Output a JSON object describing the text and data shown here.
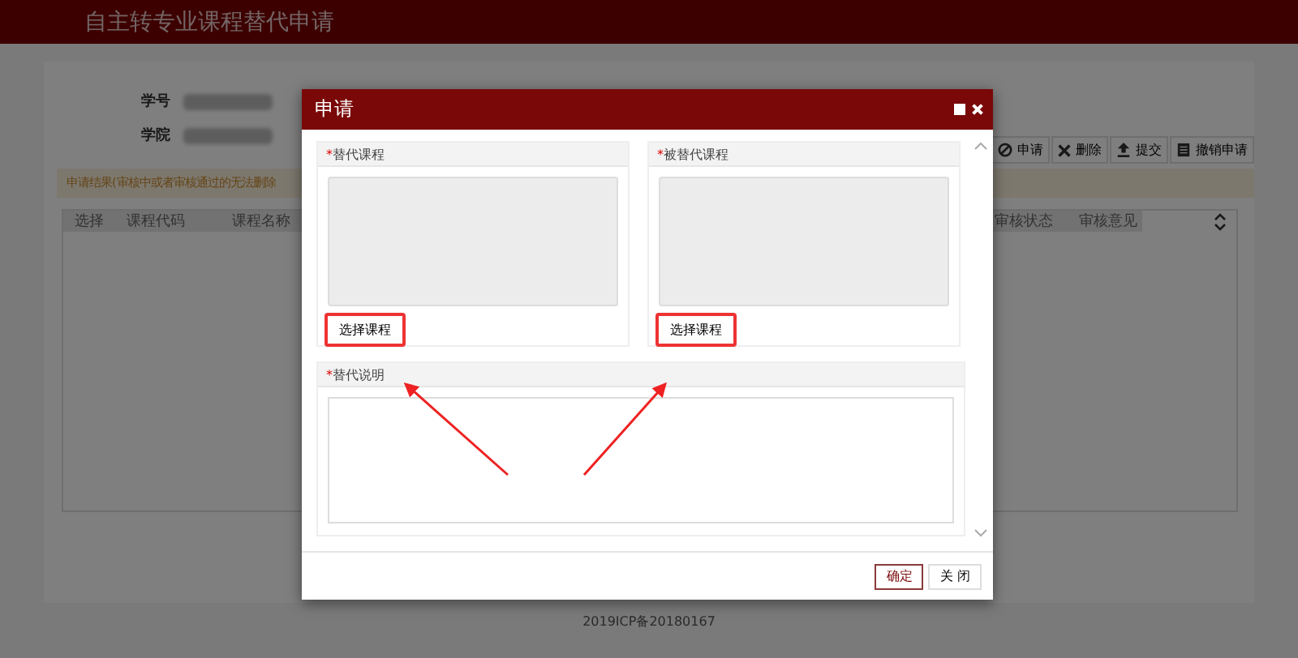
{
  "page": {
    "title": "自主转专业课程替代申请",
    "student_fields": [
      {
        "label": "学号"
      },
      {
        "label": "学院"
      }
    ],
    "toolbar": [
      {
        "label": "申请",
        "kind": "apply"
      },
      {
        "label": "删除",
        "kind": "delete"
      },
      {
        "label": "提交",
        "kind": "submit"
      },
      {
        "label": "撤销申请",
        "kind": "revoke"
      }
    ],
    "notice": "申请结果(审核中或者审核通过的无法删除",
    "table": {
      "columns": [
        "选择",
        "课程代码",
        "课程名称",
        "审核状态",
        "审核意见"
      ]
    },
    "footer": "2019ICP备20180167"
  },
  "dialog": {
    "title": "申请",
    "panels": [
      {
        "required_mark": "*",
        "label": "替代课程",
        "button": {
          "label": "选择课程",
          "highlighted": true
        }
      },
      {
        "required_mark": "*",
        "label": "被替代课程",
        "button": {
          "label": "选择课程",
          "highlighted": true
        }
      }
    ],
    "description": {
      "required_mark": "*",
      "label": "替代说明"
    },
    "buttons": [
      {
        "label": "确定",
        "kind": "primary"
      },
      {
        "label": "关 闭",
        "kind": "default"
      }
    ]
  }
}
